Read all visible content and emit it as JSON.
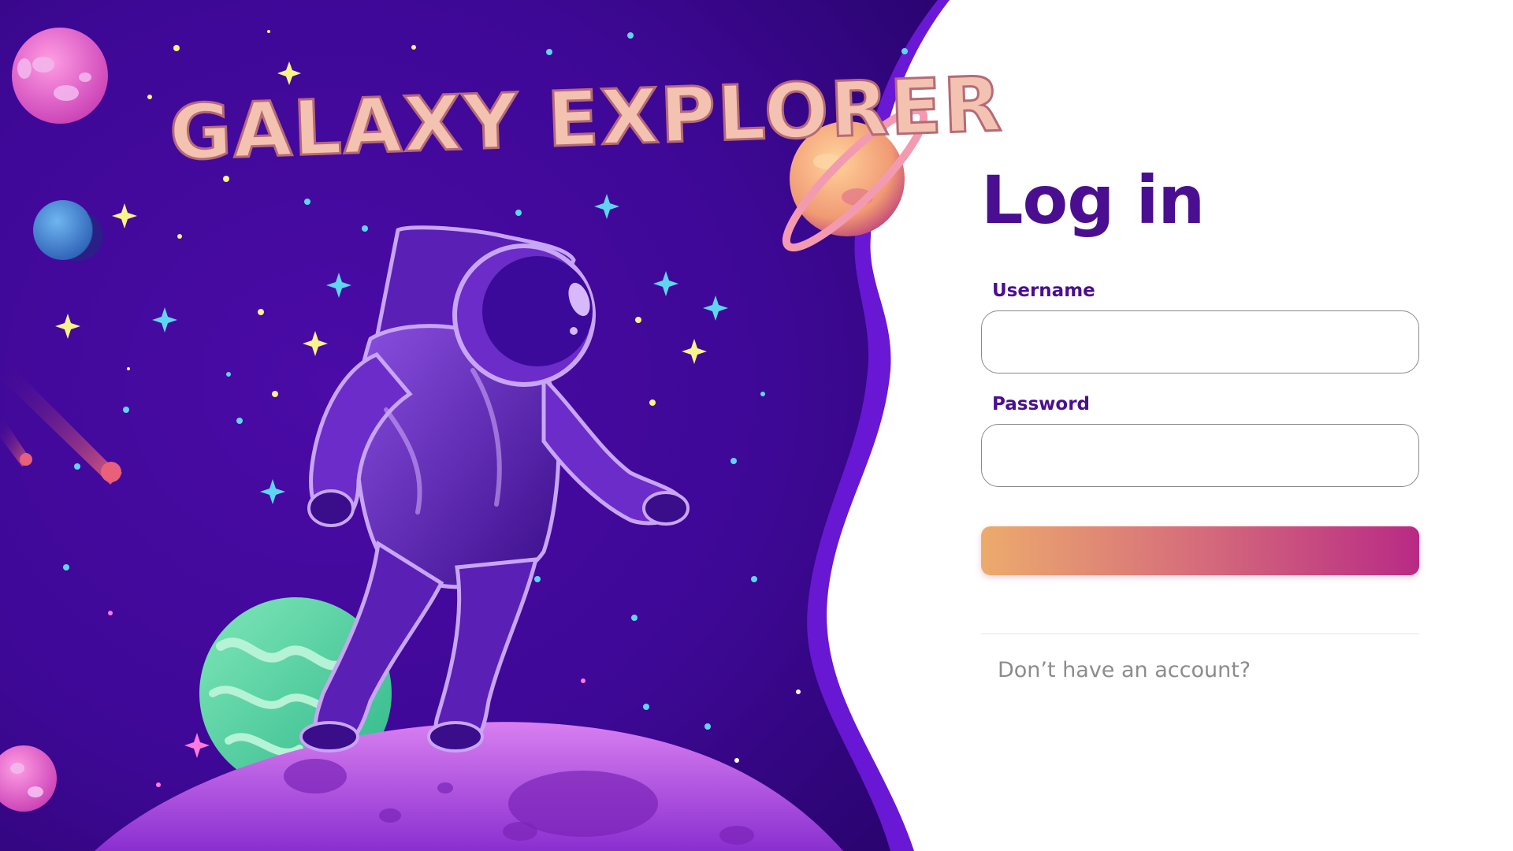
{
  "brand": {
    "title": "GALAXY EXPLORER",
    "colors": {
      "title_fill": "#f4c2b0",
      "title_outline": "#b56a77",
      "space_deep": "#2b0472",
      "space_mid": "#4c0ba8",
      "space_light": "#6314c6"
    }
  },
  "illustration": {
    "subject": "astronaut-on-moon",
    "icons": [
      "astronaut-icon",
      "planet-icon",
      "ringed-planet-icon",
      "moon-surface-icon",
      "star-icon",
      "comet-icon"
    ]
  },
  "login": {
    "heading": "Log in",
    "username_label": "Username",
    "username_value": "",
    "username_placeholder": "",
    "password_label": "Password",
    "password_value": "",
    "password_placeholder": "",
    "submit_label": "",
    "signup_prompt": "Don’t have an account?"
  },
  "theme": {
    "accent": "#4a0f91",
    "button_gradient_start": "#ecab6d",
    "button_gradient_end": "#b82a85",
    "input_border": "#8a8a8a",
    "muted_text": "#8c8c8c"
  }
}
